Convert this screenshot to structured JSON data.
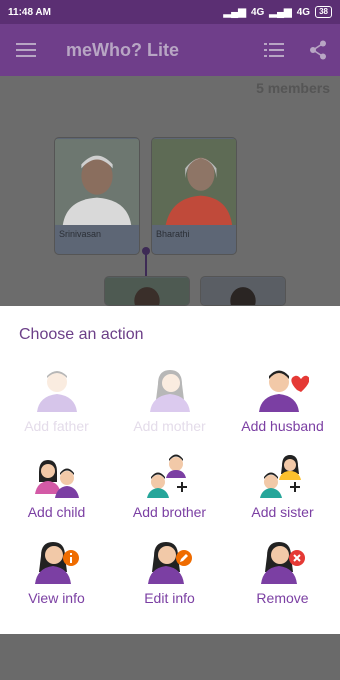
{
  "status": {
    "time": "11:48 AM",
    "signal1": "4G",
    "signal2": "4G",
    "battery": "38"
  },
  "appbar": {
    "title": "meWho? Lite",
    "menu_icon": "hamburger-menu-icon",
    "list_icon": "list-view-icon",
    "share_icon": "share-icon"
  },
  "tree": {
    "member_count": "5 members",
    "cards": [
      {
        "name": "Srinivasan"
      },
      {
        "name": "Bharathi"
      }
    ]
  },
  "sheet": {
    "title": "Choose an action",
    "actions": [
      {
        "label": "Add father",
        "enabled": false
      },
      {
        "label": "Add mother",
        "enabled": false
      },
      {
        "label": "Add husband",
        "enabled": true
      },
      {
        "label": "Add child",
        "enabled": true
      },
      {
        "label": "Add brother",
        "enabled": true
      },
      {
        "label": "Add sister",
        "enabled": true
      },
      {
        "label": "View info",
        "enabled": true
      },
      {
        "label": "Edit info",
        "enabled": true
      },
      {
        "label": "Remove",
        "enabled": true
      }
    ]
  },
  "colors": {
    "accent": "#6f3e8a",
    "label": "#7b3fa3",
    "disabled": "#e4dcea"
  }
}
